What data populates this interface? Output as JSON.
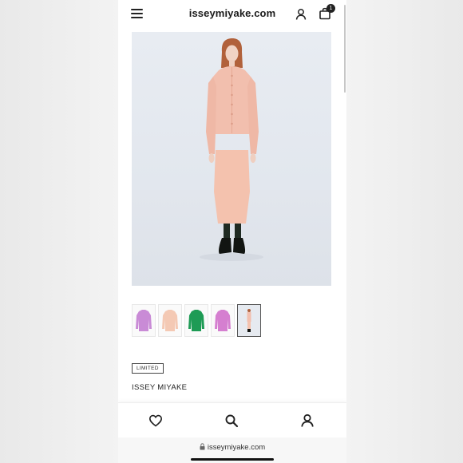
{
  "header": {
    "logo": "isseymiyake.com",
    "menu_icon": "hamburger-menu-icon",
    "account_icon": "user-icon",
    "bag_icon": "shopping-bag-icon",
    "bag_count": "1"
  },
  "product": {
    "badge": "LIMITED",
    "brand": "ISSEY MIYAKE",
    "thumbnails": [
      {
        "name": "lilac cardigan",
        "color": "#c98bd6"
      },
      {
        "name": "peach cardigan",
        "color": "#f4c9b4"
      },
      {
        "name": "green cardigan",
        "color": "#1e9b55"
      },
      {
        "name": "pink-purple cardigan",
        "color": "#d57fd0"
      },
      {
        "name": "full look",
        "color": "#e9b7a4"
      }
    ]
  },
  "bottom_nav": {
    "favorites_icon": "heart-icon",
    "search_icon": "search-icon",
    "account_icon": "user-icon"
  },
  "browser": {
    "url": "isseymiyake.com",
    "lock_icon": "lock-icon"
  },
  "colors": {
    "accent": "#222222",
    "outfit": "#f2c1ae",
    "background": "#e2e7ee"
  }
}
